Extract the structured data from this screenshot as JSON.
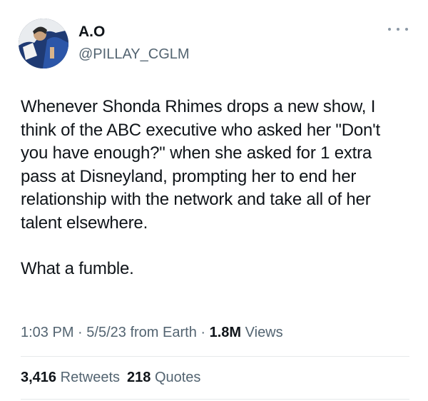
{
  "author": {
    "display_name": "A.O",
    "handle": "@PILLAY_CGLM"
  },
  "tweet": {
    "paragraphs": [
      "Whenever Shonda Rhimes drops a new show, I think of the ABC executive who asked her \"Don't you have enough?\" when she asked for 1 extra pass at Disneyland, prompting her to end her relationship with the network and take all of her talent elsewhere.",
      "What a fumble."
    ]
  },
  "meta": {
    "time": "1:03 PM",
    "date": "5/5/23",
    "source": "from Earth",
    "separator": "·",
    "views_count": "1.8M",
    "views_label": "Views"
  },
  "stats": {
    "retweets_count": "3,416",
    "retweets_label": "Retweets",
    "quotes_count": "218",
    "quotes_label": "Quotes"
  },
  "icons": {
    "more": "more-horizontal-icon"
  },
  "colors": {
    "text_primary": "#0f1419",
    "text_secondary": "#536471",
    "divider": "#e6e9eb",
    "avatar_bg": "#1d2b4a"
  }
}
